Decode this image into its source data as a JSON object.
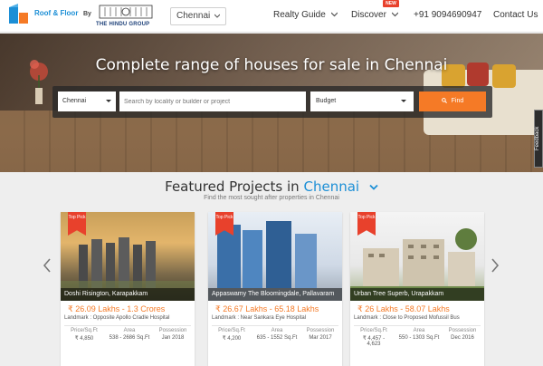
{
  "header": {
    "brand": "Roof & Floor",
    "by": "By",
    "partner": "THE HINDU GROUP",
    "city_select": "Chennai",
    "nav": [
      {
        "label": "Realty Guide"
      },
      {
        "label": "Discover"
      },
      {
        "label": "+91 9094690947"
      },
      {
        "label": "Contact Us"
      }
    ],
    "new_badge": "NEW"
  },
  "hero": {
    "title": "Complete range of houses for sale in Chennai",
    "search": {
      "city": "Chennai",
      "placeholder": "Search by locality or builder or project",
      "budget": "Budget",
      "find": "Find"
    },
    "feedback": "Feedback"
  },
  "featured": {
    "title_prefix": "Featured Projects in",
    "title_city": "Chennai",
    "subtitle": "Find the most sought after properties in Chennai",
    "cards": [
      {
        "ribbon": "Top Pick",
        "name": "Doshi Risington, Karapakkam",
        "price": "₹  26.09 Lakhs - 1.3 Crores",
        "landmark": "Landmark : Opposite Apollo Cradle Hospital",
        "stats": [
          {
            "k": "Price/Sq.Ft",
            "v": "₹ 4,850"
          },
          {
            "k": "Area",
            "v": "538 - 2686 Sq.Ft"
          },
          {
            "k": "Possession",
            "v": "Jan 2018"
          }
        ]
      },
      {
        "ribbon": "Top Pick",
        "name": "Appaswamy The Bloomingdale, Pallavaram",
        "price": "₹  26.67 Lakhs - 65.18 Lakhs",
        "landmark": "Landmark : Near Sankara Eye Hospital",
        "stats": [
          {
            "k": "Price/Sq.Ft",
            "v": "₹ 4,200"
          },
          {
            "k": "Area",
            "v": "635 - 1552 Sq.Ft"
          },
          {
            "k": "Possession",
            "v": "Mar 2017"
          }
        ]
      },
      {
        "ribbon": "Top Pick",
        "name": "Urban Tree Superb, Urapakkam",
        "price": "₹  26 Lakhs - 58.07 Lakhs",
        "landmark": "Landmark : Close to Proposed Mofussil Bus",
        "stats": [
          {
            "k": "Price/Sq.Ft",
            "v": "₹ 4,457 - 4,623"
          },
          {
            "k": "Area",
            "v": "550 - 1303 Sq.Ft"
          },
          {
            "k": "Possession",
            "v": "Dec 2016"
          }
        ]
      }
    ]
  },
  "colors": {
    "brand_blue": "#1c8fd6",
    "accent_orange": "#f57a26",
    "ribbon_red": "#e8412c"
  },
  "icons": [
    "roof-floor-logo-icon",
    "hindu-crest-icon",
    "chevron-down-icon",
    "search-icon",
    "arrow-left-icon",
    "arrow-right-icon"
  ]
}
